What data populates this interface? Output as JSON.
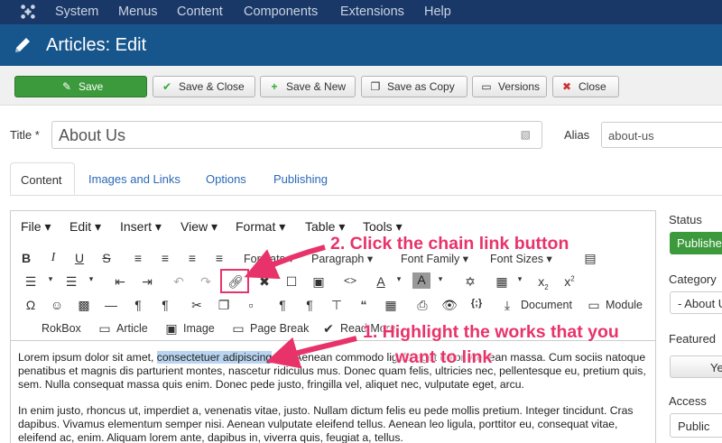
{
  "topnav": [
    "System",
    "Menus",
    "Content",
    "Components",
    "Extensions",
    "Help"
  ],
  "page_title": "Articles: Edit",
  "toolbar": {
    "save": "Save",
    "save_close": "Save & Close",
    "save_new": "Save & New",
    "save_copy": "Save as Copy",
    "versions": "Versions",
    "close": "Close"
  },
  "form": {
    "title_label": "Title *",
    "title_value": "About Us",
    "alias_label": "Alias",
    "alias_value": "about-us"
  },
  "tabs": [
    "Content",
    "Images and Links",
    "Options",
    "Publishing"
  ],
  "editor": {
    "menus": [
      "File",
      "Edit",
      "Insert",
      "View",
      "Format",
      "Table",
      "Tools"
    ],
    "formats": "Formats",
    "paragraph": "Paragraph",
    "font_family": "Font Family",
    "font_sizes": "Font Sizes",
    "document": "Document",
    "module": "Module",
    "rokbox": "RokBox",
    "article": "Article",
    "image": "Image",
    "page_break": "Page Break",
    "read_more": "Read More",
    "para1_a": "Lorem ipsum dolor sit amet, ",
    "para1_hl": "consectetuer adipiscing",
    "para1_b": " elit. Aenean commodo ligula eget dolor. Aenean massa. Cum sociis natoque penatibus et magnis dis parturient montes, nascetur ridiculus mus. Donec quam felis, ultricies nec, pellentesque eu, pretium quis, sem. Nulla consequat massa quis enim. Donec pede justo, fringilla vel, aliquet nec, vulputate eget, arcu.",
    "para2": "In enim justo, rhoncus ut, imperdiet a, venenatis vitae, justo. Nullam dictum felis eu pede mollis pretium. Integer tincidunt. Cras dapibus. Vivamus elementum semper nisi. Aenean vulputate eleifend tellus. Aenean leo ligula, porttitor eu, consequat vitae, eleifend ac, enim. Aliquam lorem ante, dapibus in, viverra quis, feugiat a, tellus."
  },
  "sidebar": {
    "status_label": "Status",
    "status_value": "Published",
    "category_label": "Category",
    "category_value": "- About Us",
    "featured_label": "Featured",
    "featured_value": "Yes",
    "access_label": "Access",
    "access_value": "Public"
  },
  "annotations": {
    "step2": "2. Click the chain link button",
    "step1_line1": "1. Highlight the works that you",
    "step1_line2": "want to link"
  },
  "colors": {
    "topbar": "#1a3867",
    "header": "#17568c",
    "save_green": "#3c9a3c",
    "annotation_pink": "#e8336a",
    "link_blue": "#2a69b8"
  }
}
